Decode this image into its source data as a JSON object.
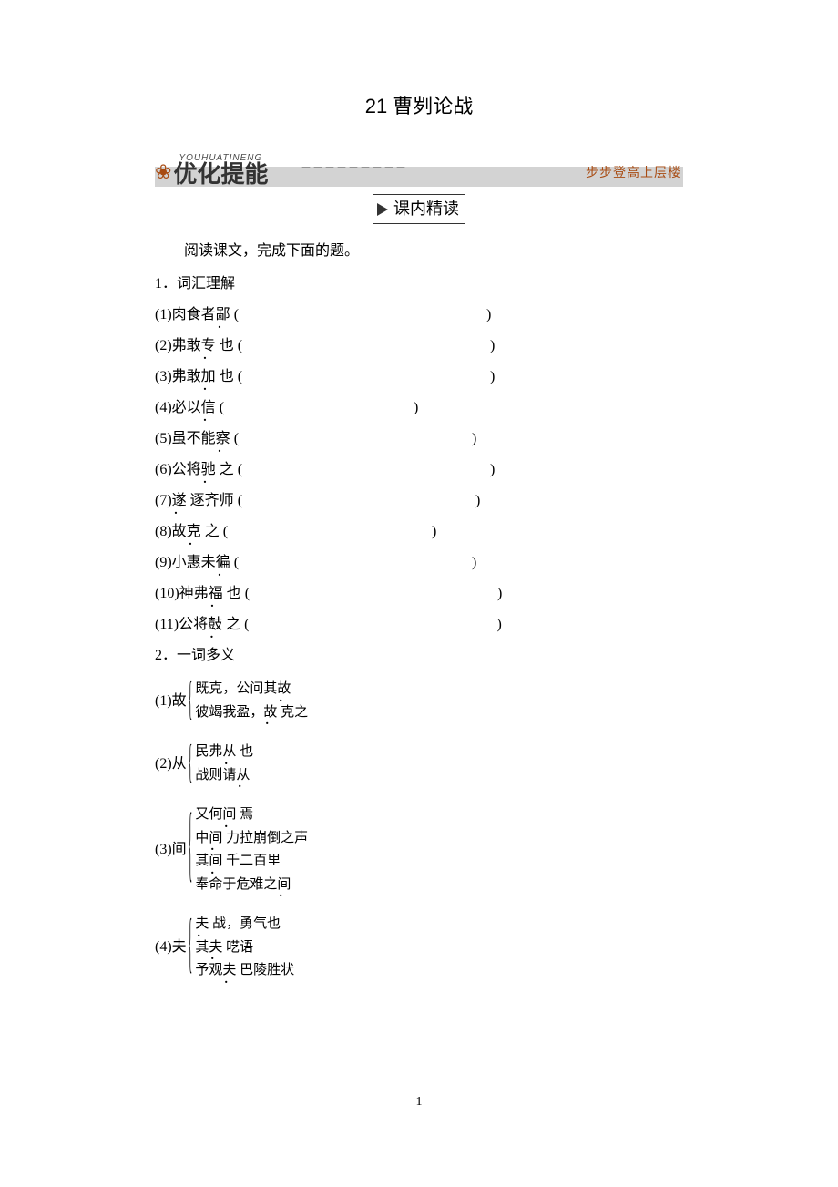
{
  "title": "21 曹刿论战",
  "banner": {
    "pinyin": "YOUHUATINENG",
    "main": "优化提能",
    "dashes": "－－－－－－－－－",
    "tagline": "步步登高上层楼"
  },
  "section_label": "课内精读",
  "instruction": "阅读课文，完成下面的题。",
  "q1": {
    "head": "1．词汇理解",
    "items": [
      {
        "pre": "(1)肉食者",
        "dot": "鄙",
        "post": "",
        "gap": 17
      },
      {
        "pre": "(2)弗敢",
        "dot": "专",
        "post": " 也",
        "gap": 17
      },
      {
        "pre": "(3)弗敢",
        "dot": "加",
        "post": " 也",
        "gap": 17
      },
      {
        "pre": "(4)必以",
        "dot": "信",
        "post": "",
        "gap": 13
      },
      {
        "pre": "(5)虽不能",
        "dot": "察",
        "post": "",
        "gap": 16
      },
      {
        "pre": "(6)公将",
        "dot": "驰",
        "post": " 之",
        "gap": 17
      },
      {
        "pre": "(7)",
        "dot": "遂",
        "post": " 逐齐师",
        "gap": 16
      },
      {
        "pre": "(8)故",
        "dot": "克",
        "post": " 之",
        "gap": 14
      },
      {
        "pre": "(9)小惠未",
        "dot": "徧",
        "post": "",
        "gap": 16
      },
      {
        "pre": "(10)神弗",
        "dot": "福",
        "post": " 也",
        "gap": 17
      },
      {
        "pre": "(11)公将",
        "dot": "鼓",
        "post": " 之",
        "gap": 17
      }
    ]
  },
  "q2": {
    "head": "2．一词多义",
    "groups": [
      {
        "label": "(1)故",
        "brace": "brace-2",
        "lines": [
          {
            "parts": [
              {
                "t": "既克，公问其"
              },
              {
                "t": "故",
                "d": true
              }
            ]
          },
          {
            "parts": [
              {
                "t": "彼竭我盈，"
              },
              {
                "t": "故",
                "d": true
              },
              {
                "t": " 克之"
              }
            ]
          }
        ]
      },
      {
        "label": "(2)从",
        "brace": "brace-2",
        "lines": [
          {
            "parts": [
              {
                "t": "民弗"
              },
              {
                "t": "从",
                "d": true
              },
              {
                "t": " 也"
              }
            ]
          },
          {
            "parts": [
              {
                "t": "战则请"
              },
              {
                "t": "从",
                "d": true
              }
            ]
          }
        ]
      },
      {
        "label": "(3)间",
        "brace": "brace-4",
        "lines": [
          {
            "parts": [
              {
                "t": "又何"
              },
              {
                "t": "间",
                "d": true
              },
              {
                "t": " 焉"
              }
            ]
          },
          {
            "parts": [
              {
                "t": "中"
              },
              {
                "t": "间",
                "d": true
              },
              {
                "t": " 力拉崩倒之声"
              }
            ]
          },
          {
            "parts": [
              {
                "t": "其"
              },
              {
                "t": "间",
                "d": true
              },
              {
                "t": " 千二百里"
              }
            ]
          },
          {
            "parts": [
              {
                "t": "奉命于危难之"
              },
              {
                "t": "间",
                "d": true
              }
            ]
          }
        ]
      },
      {
        "label": "(4)夫",
        "brace": "brace-3",
        "lines": [
          {
            "parts": [
              {
                "t": "夫",
                "d": true
              },
              {
                "t": " 战，勇气也"
              }
            ]
          },
          {
            "parts": [
              {
                "t": "其"
              },
              {
                "t": "夫",
                "d": true
              },
              {
                "t": " 呓语"
              }
            ]
          },
          {
            "parts": [
              {
                "t": "予观"
              },
              {
                "t": "夫",
                "d": true
              },
              {
                "t": " 巴陵胜状"
              }
            ]
          }
        ]
      }
    ]
  },
  "page_number": "1"
}
